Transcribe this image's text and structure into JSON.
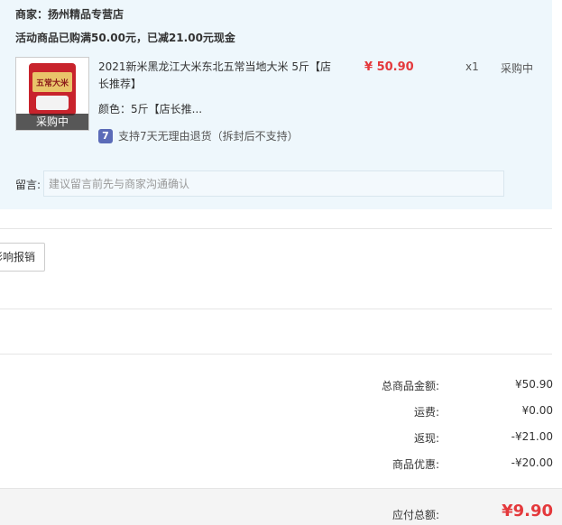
{
  "shop": {
    "name": "商家：扬州精品专营店",
    "promo": "活动商品已购满50.00元，已减21.00元现金"
  },
  "item": {
    "thumb_overlay": "采购中",
    "title": "2021新米黑龙江大米东北五常当地大米 5斤【店长推荐】",
    "spec": "颜色：5斤【店长推...",
    "price": "¥ 50.90",
    "qty": "x1",
    "status": "采购中",
    "return_badge": "7",
    "return_policy": "支持7天无理由退货（拆封后不支持）",
    "thumb_pack_text": "五常大米"
  },
  "note": {
    "label": "留言:",
    "placeholder": "建议留言前先与商家沟通确认"
  },
  "reimburse_button": "影响报销",
  "summary": [
    {
      "label": "总商品金额:",
      "value": "¥50.90"
    },
    {
      "label": "运费:",
      "value": "¥0.00"
    },
    {
      "label": "返现:",
      "value": "-¥21.00"
    },
    {
      "label": "商品优惠:",
      "value": "-¥20.00"
    }
  ],
  "payable": {
    "label": "应付总额:",
    "value": "¥9.90"
  },
  "colors": {
    "panel_bg": "#eef7fc",
    "price_red": "#e4393c",
    "badge_blue": "#5b6bb8"
  }
}
